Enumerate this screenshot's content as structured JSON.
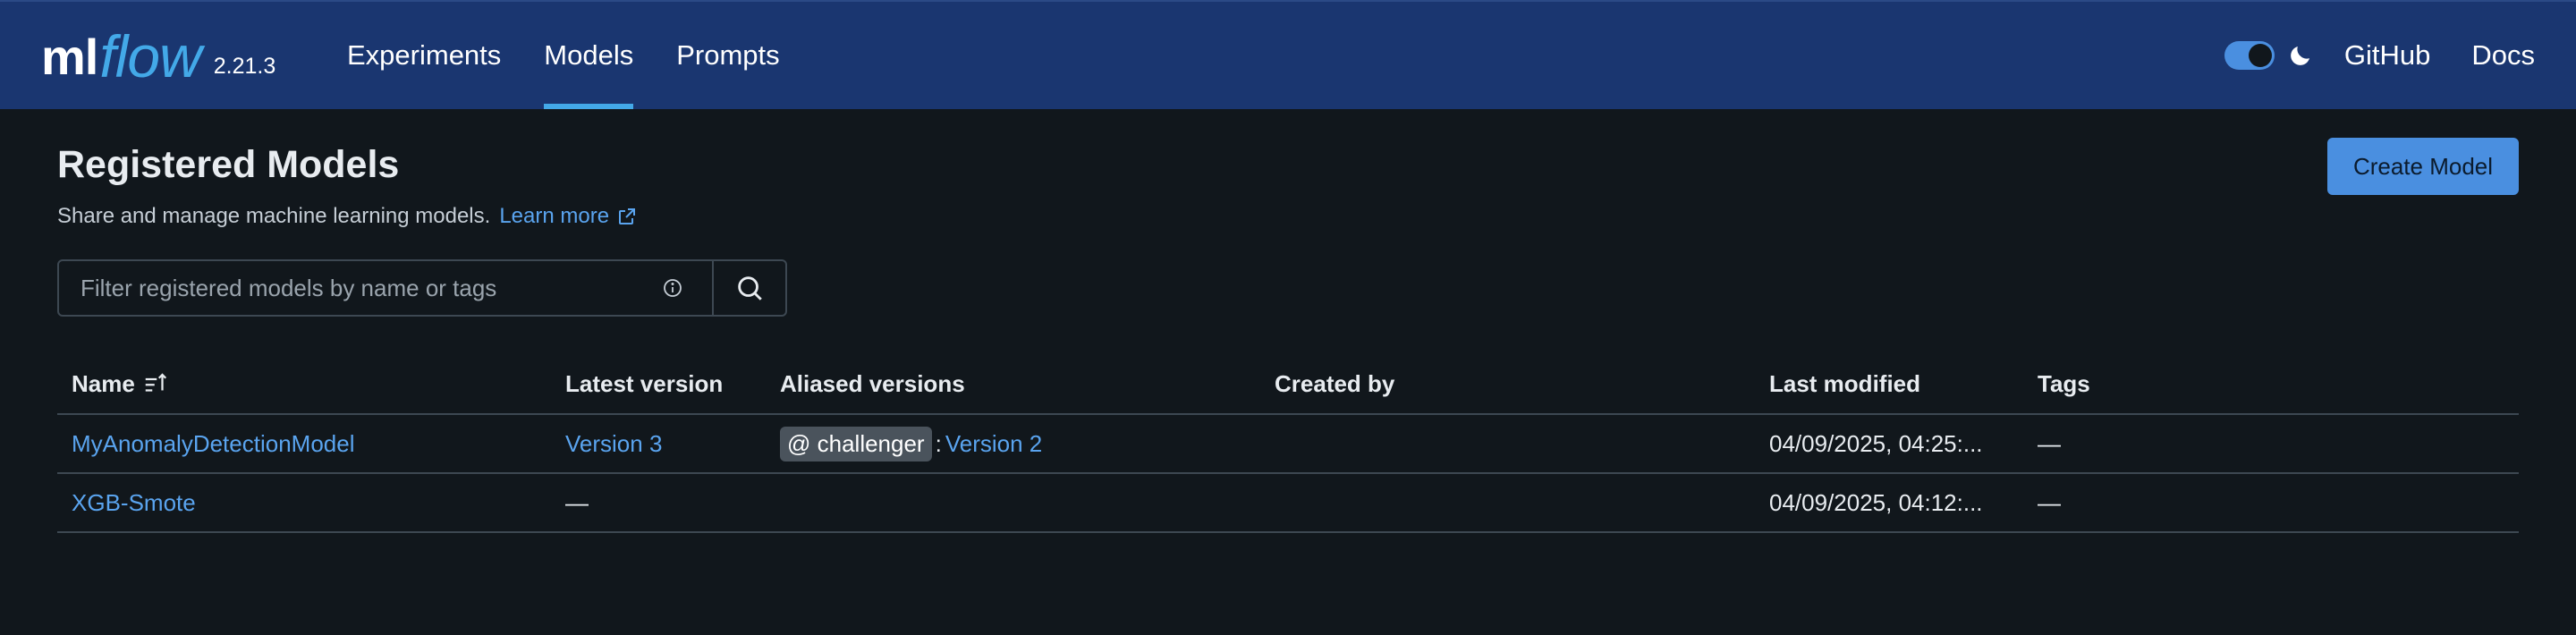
{
  "header": {
    "logo_ml": "ml",
    "logo_flow": "flow",
    "version": "2.21.3",
    "nav": [
      {
        "label": "Experiments",
        "active": false
      },
      {
        "label": "Models",
        "active": true
      },
      {
        "label": "Prompts",
        "active": false
      }
    ],
    "theme_toggle": {
      "state": "dark",
      "icon": "moon-icon"
    },
    "links": {
      "github": "GitHub",
      "docs": "Docs"
    },
    "accent_color": "#43a9e8",
    "bg_color": "#1a3670"
  },
  "page": {
    "title": "Registered Models",
    "subtitle": "Share and manage machine learning models.",
    "learn_more": "Learn more",
    "create_button": "Create Model"
  },
  "search": {
    "placeholder": "Filter registered models by name or tags",
    "value": ""
  },
  "table": {
    "columns": {
      "name": "Name",
      "latest": "Latest version",
      "aliased": "Aliased versions",
      "created_by": "Created by",
      "last_modified": "Last modified",
      "tags": "Tags"
    },
    "rows": [
      {
        "name": "MyAnomalyDetectionModel",
        "latest": "Version 3",
        "alias_tag": "@ challenger",
        "alias_sep": ":",
        "alias_version": "Version 2",
        "created_by": "",
        "last_modified": "04/09/2025, 04:25:...",
        "tags": "—"
      },
      {
        "name": "XGB-Smote",
        "latest": "—",
        "alias_tag": "",
        "alias_sep": "",
        "alias_version": "",
        "created_by": "",
        "last_modified": "04/09/2025, 04:12:...",
        "tags": "—"
      }
    ]
  }
}
